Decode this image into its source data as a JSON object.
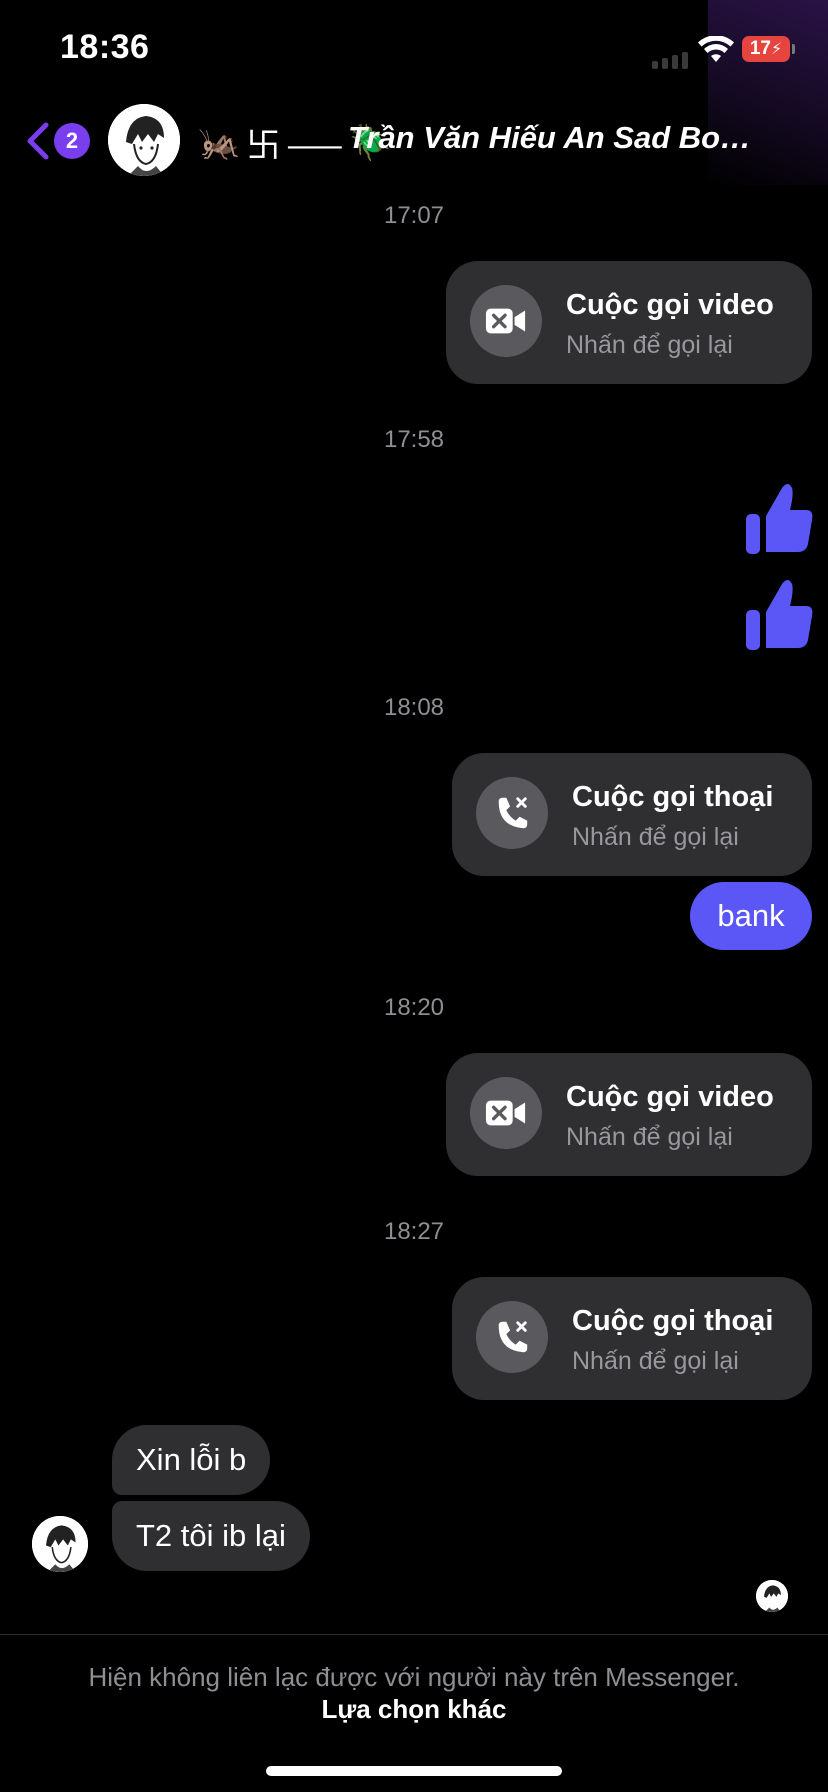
{
  "status_bar": {
    "time": "18:36",
    "battery": "17"
  },
  "header": {
    "unread_count": "2",
    "name_symbols": [
      "🦗",
      "卐",
      "⸺",
      "🪲"
    ],
    "contact_name": "Trần Văn Hiếu An Sad Bo…"
  },
  "messages": {
    "sep1": "17:07",
    "call1": {
      "title": "Cuộc gọi video",
      "subtitle": "Nhấn để gọi lại",
      "icon": "video-call-missed-icon"
    },
    "sep2": "17:58",
    "sep3": "18:08",
    "call2": {
      "title": "Cuộc gọi thoại",
      "subtitle": "Nhấn để gọi lại",
      "icon": "phone-call-missed-icon"
    },
    "text_me": "bank",
    "sep4": "18:20",
    "call3": {
      "title": "Cuộc gọi video",
      "subtitle": "Nhấn để gọi lại",
      "icon": "video-call-missed-icon"
    },
    "sep5": "18:27",
    "call4": {
      "title": "Cuộc gọi thoại",
      "subtitle": "Nhấn để gọi lại",
      "icon": "phone-call-missed-icon"
    },
    "them1": "Xin lỗi b",
    "them2": "T2 tôi ib lại"
  },
  "footer": {
    "notice": "Hiện không liên lạc được với người này trên Messenger.",
    "action": "Lựa chọn khác"
  },
  "colors": {
    "accent": "#5b57f7",
    "badge": "#7a3df0",
    "bubble": "#2f2f31"
  }
}
